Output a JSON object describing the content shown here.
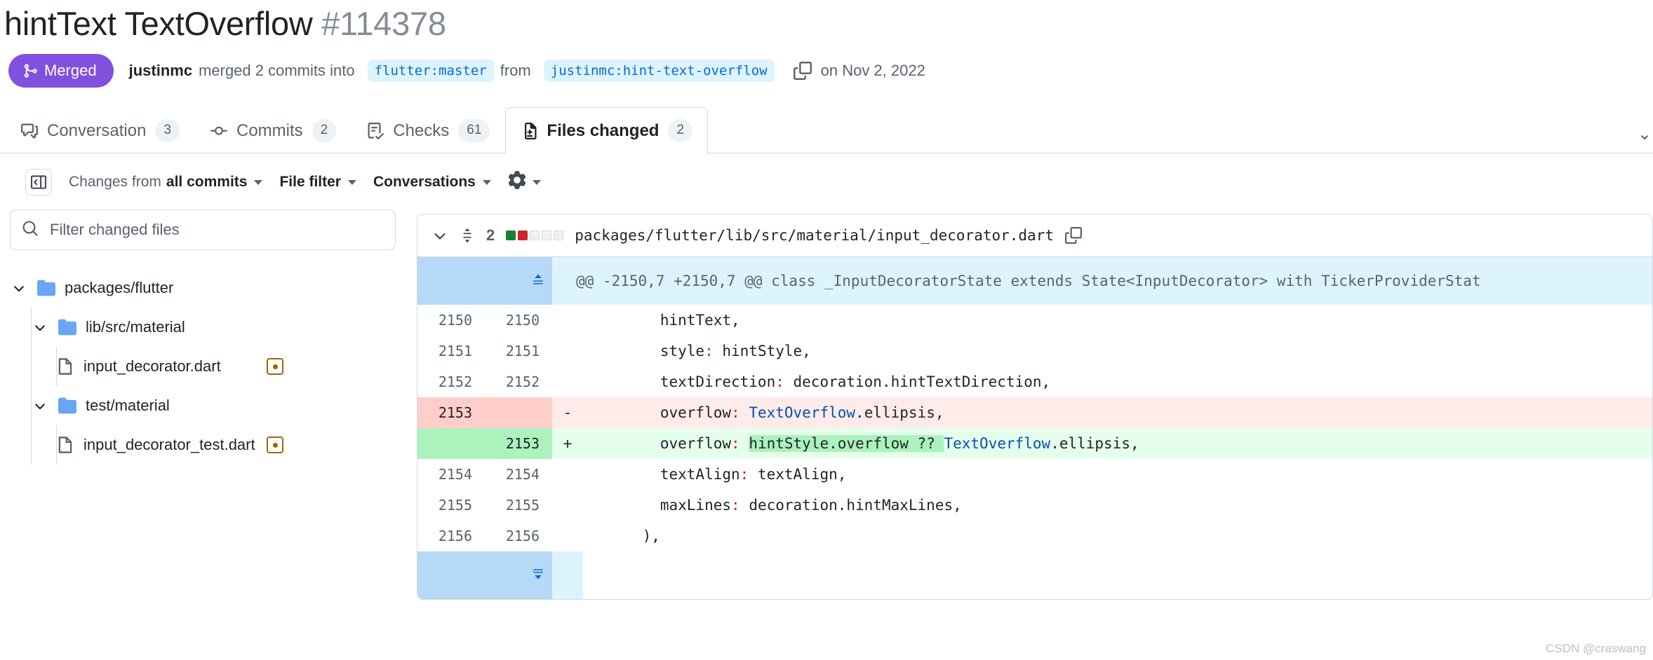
{
  "header": {
    "title": "hintText TextOverflow",
    "number": "#114378"
  },
  "status": {
    "state_label": "Merged",
    "state_color": "#8250df",
    "state_icon": "git-merge-icon",
    "author": "justinmc",
    "action_text": "merged 2 commits into",
    "base_branch": "flutter:master",
    "from_text": "from",
    "head_branch": "justinmc:hint-text-overflow",
    "copy_icon": "copy-icon",
    "date": "on Nov 2, 2022"
  },
  "tabs": [
    {
      "label": "Conversation",
      "count": "3",
      "icon": "comment-discussion-icon",
      "active": false
    },
    {
      "label": "Commits",
      "count": "2",
      "icon": "git-commit-icon",
      "active": false
    },
    {
      "label": "Checks",
      "count": "61",
      "icon": "checklist-icon",
      "active": false
    },
    {
      "label": "Files changed",
      "count": "2",
      "icon": "file-diff-icon",
      "active": true
    }
  ],
  "toolbar": {
    "sidebar_toggle_icon": "sidebar-collapse-icon",
    "changes_from_prefix": "Changes from",
    "changes_from_value": "all commits",
    "file_filter_label": "File filter",
    "conversations_label": "Conversations",
    "settings_icon": "gear-icon"
  },
  "sidebar": {
    "search": {
      "icon": "search-icon",
      "placeholder": "Filter changed files",
      "value": ""
    },
    "tree": [
      {
        "type": "folder",
        "label": "packages/flutter",
        "indent": 0,
        "expanded": true,
        "status": ""
      },
      {
        "type": "folder",
        "label": "lib/src/material",
        "indent": 1,
        "expanded": true,
        "status": ""
      },
      {
        "type": "file",
        "label": "input_decorator.dart",
        "indent": 2,
        "expanded": false,
        "status": "modified"
      },
      {
        "type": "folder",
        "label": "test/material",
        "indent": 1,
        "expanded": true,
        "status": ""
      },
      {
        "type": "file",
        "label": "input_decorator_test.dart",
        "indent": 2,
        "expanded": false,
        "status": "modified"
      }
    ]
  },
  "diff": {
    "collapse_icon": "chevron-down-icon",
    "resize_icon": "unfold-icon",
    "change_count": "2",
    "stat_blocks": [
      "add",
      "del",
      "neutral",
      "neutral",
      "neutral"
    ],
    "file_path": "packages/flutter/lib/src/material/input_decorator.dart",
    "copy_icon": "copy-icon",
    "expand_up_icon": "expand-up-icon",
    "expand_down_icon": "expand-down-icon",
    "hunk_header": "@@ -2150,7 +2150,7 @@ class _InputDecoratorState extends State<InputDecorator> with TickerProviderStat",
    "rows": [
      {
        "kind": "context",
        "old": "2150",
        "new": "2150",
        "marker": "",
        "code": "      hintText,"
      },
      {
        "kind": "context",
        "old": "2151",
        "new": "2151",
        "marker": "",
        "code": "      style: hintStyle,"
      },
      {
        "kind": "context",
        "old": "2152",
        "new": "2152",
        "marker": "",
        "code": "      textDirection: decoration.hintTextDirection,"
      },
      {
        "kind": "delete",
        "old": "2153",
        "new": "",
        "marker": "-",
        "code": "      overflow: TextOverflow.ellipsis,"
      },
      {
        "kind": "add",
        "old": "",
        "new": "2153",
        "marker": "+",
        "code": "      overflow: hintStyle.overflow ?? TextOverflow.ellipsis,"
      },
      {
        "kind": "context",
        "old": "2154",
        "new": "2154",
        "marker": "",
        "code": "      textAlign: textAlign,"
      },
      {
        "kind": "context",
        "old": "2155",
        "new": "2155",
        "marker": "",
        "code": "      maxLines: decoration.hintMaxLines,"
      },
      {
        "kind": "context",
        "old": "2156",
        "new": "2156",
        "marker": "",
        "code": "    ),"
      }
    ]
  },
  "watermark": "CSDN @craswang"
}
